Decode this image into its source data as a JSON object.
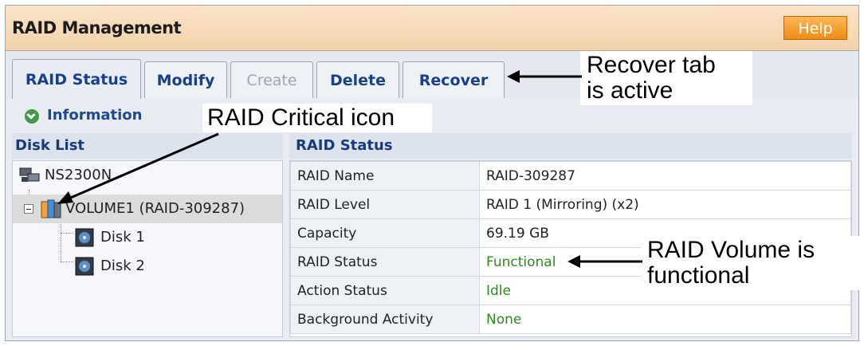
{
  "window": {
    "title": "RAID Management",
    "help_label": "Help"
  },
  "tabs": [
    {
      "label": "RAID Status",
      "state": "active"
    },
    {
      "label": "Modify",
      "state": "normal"
    },
    {
      "label": "Create",
      "state": "disabled"
    },
    {
      "label": "Delete",
      "state": "normal"
    },
    {
      "label": "Recover",
      "state": "normal"
    }
  ],
  "info": {
    "icon": "check-circle-icon",
    "label": "Information"
  },
  "disk_list": {
    "header": "Disk List",
    "items": [
      {
        "label": "NS2300N",
        "icon": "server-icon"
      },
      {
        "label": "VOLUME1 (RAID-309287)",
        "icon": "raid-critical-icon"
      },
      {
        "label": "Disk 1",
        "icon": "disk-icon"
      },
      {
        "label": "Disk 2",
        "icon": "disk-icon"
      }
    ]
  },
  "raid_status": {
    "header": "RAID Status",
    "rows": [
      {
        "label": "RAID Name",
        "value": "RAID-309287"
      },
      {
        "label": "RAID Level",
        "value": "RAID 1 (Mirroring) (x2)"
      },
      {
        "label": "Capacity",
        "value": "69.19 GB"
      },
      {
        "label": "RAID Status",
        "value": "Functional"
      },
      {
        "label": "Action Status",
        "value": "Idle"
      },
      {
        "label": "Background Activity",
        "value": "None"
      }
    ]
  },
  "annotations": {
    "recover_tab": "Recover tab\nis active",
    "raid_critical": "RAID Critical icon",
    "functional": "RAID Volume is\nfunctional"
  },
  "colors": {
    "title_bar": "#f2d2ab",
    "help_button": "#f08c14",
    "tab_text": "#183f8a",
    "status_green": "#2a8a1e"
  }
}
